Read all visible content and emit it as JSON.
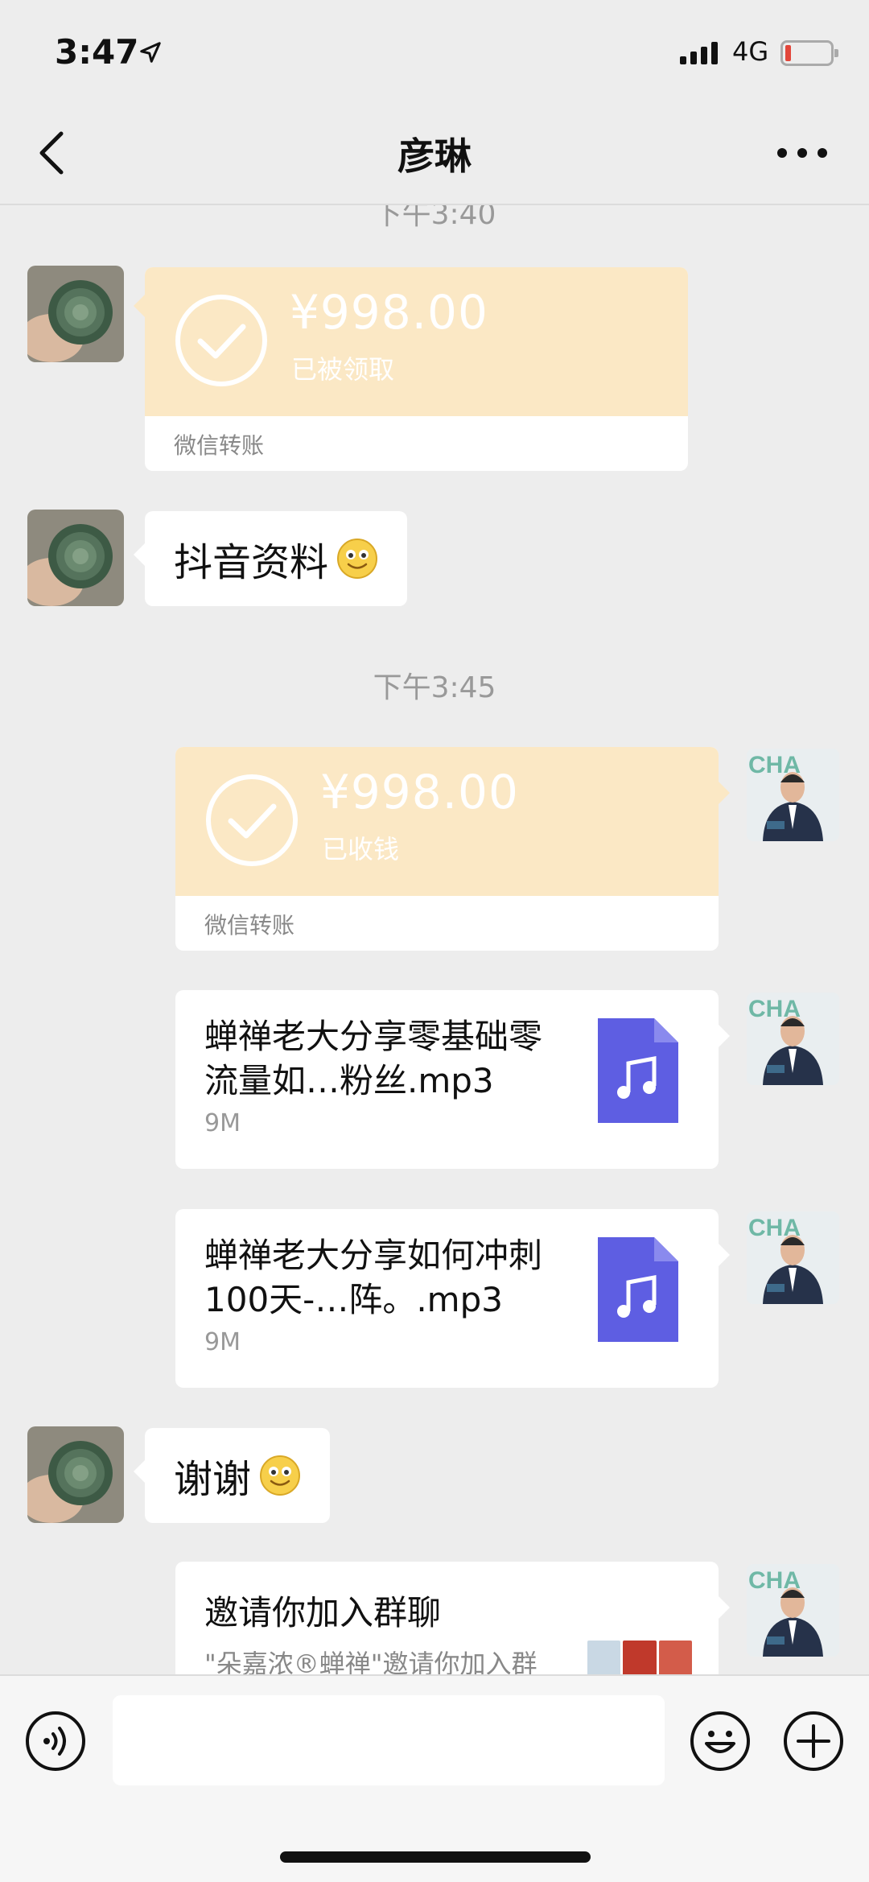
{
  "status_bar": {
    "time": "3:47",
    "network": "4G",
    "battery_low": true
  },
  "nav": {
    "title": "彦琳"
  },
  "messages": {
    "timestamp_top": "下午3:40",
    "transfer_received": {
      "amount": "¥998.00",
      "status": "已被领取",
      "footer": "微信转账"
    },
    "text_1": "抖音资料",
    "timestamp_mid": "下午3:45",
    "transfer_sent": {
      "amount": "¥998.00",
      "status": "已收钱",
      "footer": "微信转账"
    },
    "file_1": {
      "name": "蝉禅老大分享零基础零流量如…粉丝.mp3",
      "size": "9M"
    },
    "file_2": {
      "name": "蝉禅老大分享如何冲刺100天-…阵。.mp3",
      "size": "9M"
    },
    "text_2": "谢谢",
    "invite": {
      "title": "邀请你加入群聊",
      "desc": "\"朵嘉浓®蝉禅\"邀请你加入群"
    }
  },
  "colors": {
    "background": "#ededed",
    "transfer": "#fbe8c5",
    "file_icon": "#5e5ee2",
    "bubble": "#ffffff"
  }
}
